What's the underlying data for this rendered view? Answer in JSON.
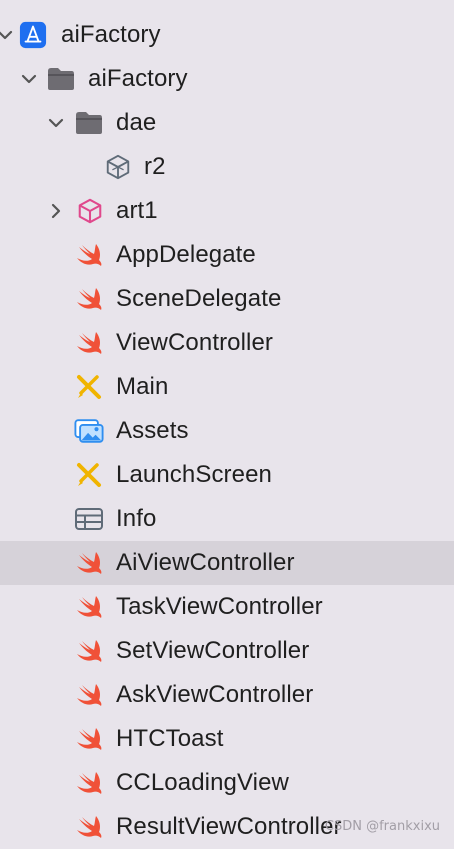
{
  "project_navigator": {
    "items": [
      {
        "label": "aiFactory",
        "icon": "xcode-project-icon",
        "chevron": "down"
      },
      {
        "label": "aiFactory",
        "icon": "folder-icon",
        "chevron": "down"
      },
      {
        "label": "dae",
        "icon": "folder-icon",
        "chevron": "down"
      },
      {
        "label": "r2",
        "icon": "3d-model-icon",
        "chevron": "none"
      },
      {
        "label": "art1",
        "icon": "3d-cube-icon",
        "chevron": "right"
      },
      {
        "label": "AppDelegate",
        "icon": "swift-icon",
        "chevron": "none"
      },
      {
        "label": "SceneDelegate",
        "icon": "swift-icon",
        "chevron": "none"
      },
      {
        "label": "ViewController",
        "icon": "swift-icon",
        "chevron": "none"
      },
      {
        "label": "Main",
        "icon": "storyboard-icon",
        "chevron": "none"
      },
      {
        "label": "Assets",
        "icon": "asset-catalog-icon",
        "chevron": "none"
      },
      {
        "label": "LaunchScreen",
        "icon": "storyboard-icon",
        "chevron": "none"
      },
      {
        "label": "Info",
        "icon": "plist-table-icon",
        "chevron": "none"
      },
      {
        "label": "AiViewController",
        "icon": "swift-icon",
        "chevron": "none",
        "selected": true
      },
      {
        "label": "TaskViewController",
        "icon": "swift-icon",
        "chevron": "none"
      },
      {
        "label": "SetViewController",
        "icon": "swift-icon",
        "chevron": "none"
      },
      {
        "label": "AskViewController",
        "icon": "swift-icon",
        "chevron": "none"
      },
      {
        "label": "HTCToast",
        "icon": "swift-icon",
        "chevron": "none"
      },
      {
        "label": "CCLoadingView",
        "icon": "swift-icon",
        "chevron": "none"
      },
      {
        "label": "ResultViewController",
        "icon": "swift-icon",
        "chevron": "none"
      }
    ]
  },
  "watermark": "CSDN @frankxixu",
  "colors": {
    "background": "#e8e4eb",
    "selection": "#d6d2d9",
    "swift": "#f05138",
    "folder": "#6e6c72",
    "project": "#1e6ff0",
    "storyboard": "#f0b400",
    "assets": "#2f8ef0",
    "cube": "#e0488c",
    "text": "#1f1f1f"
  }
}
